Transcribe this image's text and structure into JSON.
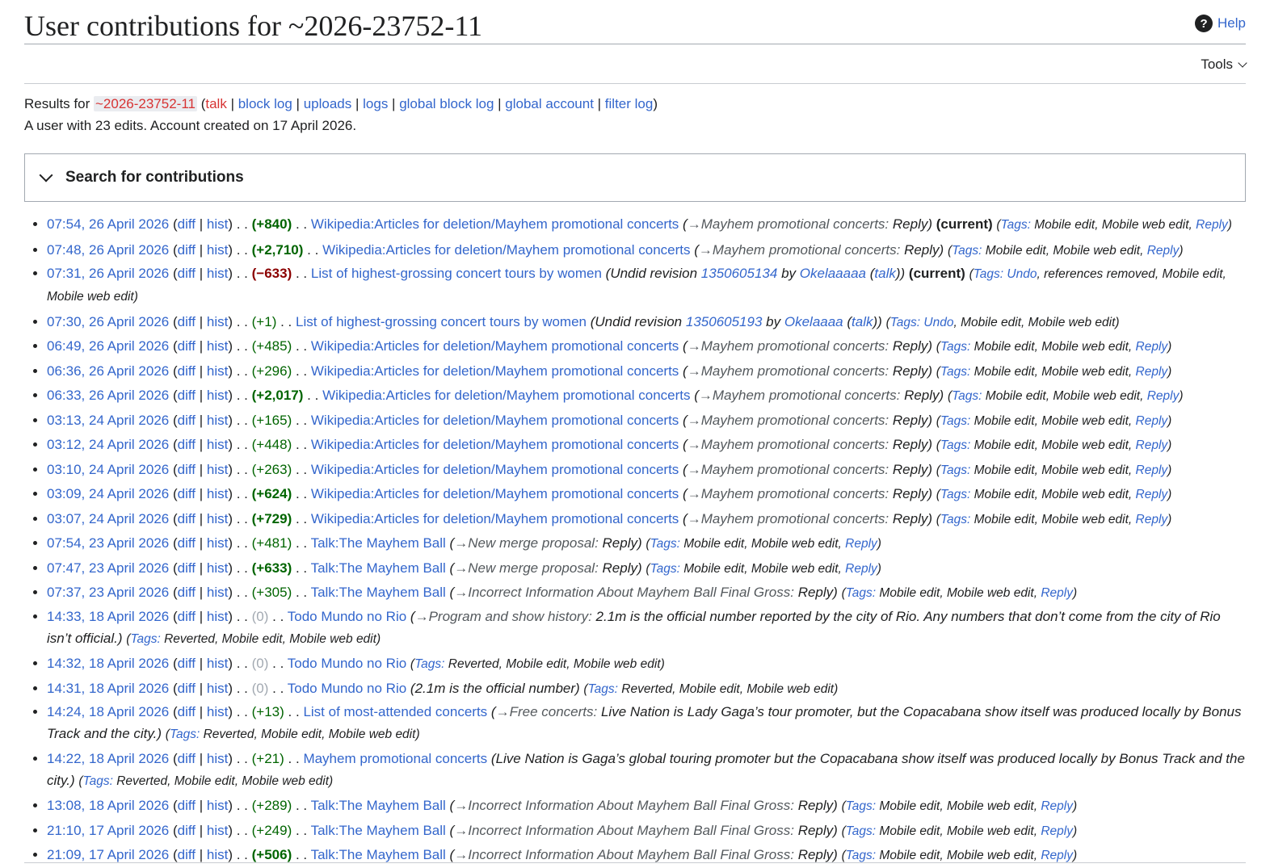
{
  "page": {
    "title": "User contributions for ~2026-23752-11",
    "help_label": "Help",
    "tools_label": "Tools"
  },
  "results": {
    "prefix": "Results for",
    "user": "~2026-23752-11",
    "talk": "talk",
    "links": [
      "block log",
      "uploads",
      "logs",
      "global block log",
      "global account",
      "filter log"
    ],
    "summary": "A user with 23 edits. Account created on 17 April 2026."
  },
  "search": {
    "label": "Search for contributions"
  },
  "labels": {
    "diff": "diff",
    "hist": "hist",
    "tags": "Tags:",
    "current": "(current)"
  },
  "contribs": [
    {
      "ts": "07:54, 26 April 2026",
      "size": "+840",
      "kind": "posb",
      "page": "Wikipedia:Articles for deletion/Mayhem promotional concerts",
      "sec": "Mayhem promotional concerts:",
      "text": "Reply",
      "current": true,
      "tags": [
        "Mobile edit",
        "Mobile web edit",
        "Reply"
      ],
      "wrapped": true
    },
    {
      "ts": "07:48, 26 April 2026",
      "size": "+2,710",
      "kind": "posb",
      "page": "Wikipedia:Articles for deletion/Mayhem promotional concerts",
      "sec": "Mayhem promotional concerts:",
      "text": "Reply",
      "tags": [
        "Mobile edit",
        "Mobile web edit",
        "Reply"
      ]
    },
    {
      "ts": "07:31, 26 April 2026",
      "size": "−633",
      "kind": "neg",
      "page": "List of highest-grossing concert tours by women",
      "undid": {
        "pre": "Undid revision",
        "rev": "1350605134",
        "by": "by",
        "user": "Okelaaaaa",
        "talk": "talk"
      },
      "current": true,
      "tags": [
        "Undo",
        "references removed",
        "Mobile edit",
        "Mobile web edit"
      ],
      "wrapped": true
    },
    {
      "ts": "07:30, 26 April 2026",
      "size": "+1",
      "kind": "pos",
      "page": "List of highest-grossing concert tours by women",
      "undid": {
        "pre": "Undid revision",
        "rev": "1350605193",
        "by": "by",
        "user": "Okelaaaa",
        "talk": "talk"
      },
      "tags": [
        "Undo",
        "Mobile edit",
        "Mobile web edit"
      ]
    },
    {
      "ts": "06:49, 26 April 2026",
      "size": "+485",
      "kind": "pos",
      "page": "Wikipedia:Articles for deletion/Mayhem promotional concerts",
      "sec": "Mayhem promotional concerts:",
      "text": "Reply",
      "tags": [
        "Mobile edit",
        "Mobile web edit",
        "Reply"
      ]
    },
    {
      "ts": "06:36, 26 April 2026",
      "size": "+296",
      "kind": "pos",
      "page": "Wikipedia:Articles for deletion/Mayhem promotional concerts",
      "sec": "Mayhem promotional concerts:",
      "text": "Reply",
      "tags": [
        "Mobile edit",
        "Mobile web edit",
        "Reply"
      ]
    },
    {
      "ts": "06:33, 26 April 2026",
      "size": "+2,017",
      "kind": "posb",
      "page": "Wikipedia:Articles for deletion/Mayhem promotional concerts",
      "sec": "Mayhem promotional concerts:",
      "text": "Reply",
      "tags": [
        "Mobile edit",
        "Mobile web edit",
        "Reply"
      ]
    },
    {
      "ts": "03:13, 24 April 2026",
      "size": "+165",
      "kind": "pos",
      "page": "Wikipedia:Articles for deletion/Mayhem promotional concerts",
      "sec": "Mayhem promotional concerts:",
      "text": "Reply",
      "tags": [
        "Mobile edit",
        "Mobile web edit",
        "Reply"
      ]
    },
    {
      "ts": "03:12, 24 April 2026",
      "size": "+448",
      "kind": "pos",
      "page": "Wikipedia:Articles for deletion/Mayhem promotional concerts",
      "sec": "Mayhem promotional concerts:",
      "text": "Reply",
      "tags": [
        "Mobile edit",
        "Mobile web edit",
        "Reply"
      ]
    },
    {
      "ts": "03:10, 24 April 2026",
      "size": "+263",
      "kind": "pos",
      "page": "Wikipedia:Articles for deletion/Mayhem promotional concerts",
      "sec": "Mayhem promotional concerts:",
      "text": "Reply",
      "tags": [
        "Mobile edit",
        "Mobile web edit",
        "Reply"
      ]
    },
    {
      "ts": "03:09, 24 April 2026",
      "size": "+624",
      "kind": "posb",
      "page": "Wikipedia:Articles for deletion/Mayhem promotional concerts",
      "sec": "Mayhem promotional concerts:",
      "text": "Reply",
      "tags": [
        "Mobile edit",
        "Mobile web edit",
        "Reply"
      ]
    },
    {
      "ts": "03:07, 24 April 2026",
      "size": "+729",
      "kind": "posb",
      "page": "Wikipedia:Articles for deletion/Mayhem promotional concerts",
      "sec": "Mayhem promotional concerts:",
      "text": "Reply",
      "tags": [
        "Mobile edit",
        "Mobile web edit",
        "Reply"
      ]
    },
    {
      "ts": "07:54, 23 April 2026",
      "size": "+481",
      "kind": "pos",
      "page": "Talk:The Mayhem Ball",
      "sec": "New merge proposal:",
      "text": "Reply",
      "tags": [
        "Mobile edit",
        "Mobile web edit",
        "Reply"
      ]
    },
    {
      "ts": "07:47, 23 April 2026",
      "size": "+633",
      "kind": "posb",
      "page": "Talk:The Mayhem Ball",
      "sec": "New merge proposal:",
      "text": "Reply",
      "tags": [
        "Mobile edit",
        "Mobile web edit",
        "Reply"
      ]
    },
    {
      "ts": "07:37, 23 April 2026",
      "size": "+305",
      "kind": "pos",
      "page": "Talk:The Mayhem Ball",
      "sec": "Incorrect Information About Mayhem Ball Final Gross:",
      "text": "Reply",
      "tags": [
        "Mobile edit",
        "Mobile web edit",
        "Reply"
      ]
    },
    {
      "ts": "14:33, 18 April 2026",
      "size": "0",
      "kind": "zero",
      "page": "Todo Mundo no Rio",
      "sec": "Program and show history:",
      "text": "2.1m is the official number reported by the city of Rio. Any numbers that don’t come from the city of Rio isn’t official.",
      "tags": [
        "Reverted",
        "Mobile edit",
        "Mobile web edit"
      ],
      "wrapped": true
    },
    {
      "ts": "14:32, 18 April 2026",
      "size": "0",
      "kind": "zero",
      "page": "Todo Mundo no Rio",
      "tags": [
        "Reverted",
        "Mobile edit",
        "Mobile web edit"
      ]
    },
    {
      "ts": "14:31, 18 April 2026",
      "size": "0",
      "kind": "zero",
      "page": "Todo Mundo no Rio",
      "plain": "2.1m is the official number",
      "tags": [
        "Reverted",
        "Mobile edit",
        "Mobile web edit"
      ]
    },
    {
      "ts": "14:24, 18 April 2026",
      "size": "+13",
      "kind": "pos",
      "page": "List of most-attended concerts",
      "sec": "Free concerts:",
      "text": "Live Nation is Lady Gaga’s tour promoter, but the Copacabana show itself was produced locally by Bonus Track and the city.",
      "tags": [
        "Reverted",
        "Mobile edit",
        "Mobile web edit"
      ],
      "wrapped": true
    },
    {
      "ts": "14:22, 18 April 2026",
      "size": "+21",
      "kind": "pos",
      "page": "Mayhem promotional concerts",
      "plain": "Live Nation is Gaga’s global touring promoter but the Copacabana show itself was produced locally by Bonus Track and the city.",
      "tags": [
        "Reverted",
        "Mobile edit",
        "Mobile web edit"
      ],
      "wrapped": true
    },
    {
      "ts": "13:08, 18 April 2026",
      "size": "+289",
      "kind": "pos",
      "page": "Talk:The Mayhem Ball",
      "sec": "Incorrect Information About Mayhem Ball Final Gross:",
      "text": "Reply",
      "tags": [
        "Mobile edit",
        "Mobile web edit",
        "Reply"
      ]
    },
    {
      "ts": "21:10, 17 April 2026",
      "size": "+249",
      "kind": "pos",
      "page": "Talk:The Mayhem Ball",
      "sec": "Incorrect Information About Mayhem Ball Final Gross:",
      "text": "Reply",
      "tags": [
        "Mobile edit",
        "Mobile web edit",
        "Reply"
      ]
    },
    {
      "ts": "21:09, 17 April 2026",
      "size": "+506",
      "kind": "posb",
      "page": "Talk:The Mayhem Ball",
      "sec": "Incorrect Information About Mayhem Ball Final Gross:",
      "text": "Reply",
      "tags": [
        "Mobile edit",
        "Mobile web edit",
        "Reply"
      ]
    }
  ]
}
